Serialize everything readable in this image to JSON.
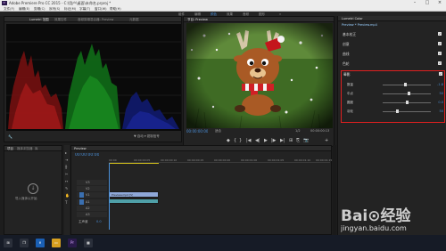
{
  "window": {
    "title": "Adobe Premiere Pro CC 2015 - C:\\用户\\桌面\\未命名.prproj *",
    "icon": "Pr"
  },
  "menu": [
    "文件(F)",
    "编辑(E)",
    "剪辑(C)",
    "序列(S)",
    "标记(M)",
    "字幕(T)",
    "窗口(W)",
    "帮助(H)"
  ],
  "workspace_tabs": [
    "组件",
    "编辑",
    "颜色",
    "效果",
    "音频",
    "图形"
  ],
  "workspace_active": "颜色",
  "scopes": {
    "tabs": [
      "Lumetri 范围",
      "效果控件",
      "音频剪辑混合器: Preview",
      "元数据"
    ],
    "active_tab": "Lumetri 范围",
    "bottom_label": "▼ 自动 ▾ 钳制信号"
  },
  "program": {
    "tab_label": "节目: Preview",
    "timecode": "00:00:00:00",
    "fit": "适合",
    "fraction": "1/2",
    "duration": "00:00:00:13",
    "transport": [
      "◆",
      "{",
      "}",
      "|◀",
      "◀|",
      "▶",
      "|▶",
      "▶|",
      "⊞",
      "⎘",
      "📷",
      "+"
    ]
  },
  "lumetri": {
    "tabs": [
      "Lumetri Color",
      "Preview * Preview.mp4"
    ],
    "sections": [
      {
        "label": "基本校正"
      },
      {
        "label": "创意"
      },
      {
        "label": "曲线"
      },
      {
        "label": "色轮"
      },
      {
        "label": "HSL 辅助"
      }
    ],
    "vignette": {
      "title": "晕影",
      "controls": [
        {
          "label": "数量",
          "value": "-1.8",
          "position": 0.48
        },
        {
          "label": "中点",
          "value": "50",
          "position": 0.55
        },
        {
          "label": "圆度",
          "value": "0.0",
          "position": 0.5
        },
        {
          "label": "羽化",
          "value": "50",
          "position": 0.3
        }
      ]
    }
  },
  "project": {
    "tabs": [
      "项目",
      "媒体浏览器",
      "库"
    ],
    "import_text": "导入媒体以开始"
  },
  "timeline": {
    "tab": "Preview",
    "timecode": "00:00:00:00",
    "ruler": [
      "00:00",
      "00:00:00:05",
      "00:00:00:10",
      "00:00:00:15",
      "00:00:00:20",
      "00:00:01:00",
      "00:00:01:05",
      "00:00:01:10",
      "00:00:01:15"
    ],
    "video_tracks": [
      "V3",
      "V2",
      "V1"
    ],
    "audio_tracks": [
      "A1",
      "A2",
      "A3"
    ],
    "master": "主声道",
    "master_value": "0.0",
    "clip_label": "Preview.mp4 [V]"
  },
  "watermark": {
    "brand": "Bai⊙经验",
    "url": "jingyan.baidu.com"
  },
  "colors": {
    "accent": "#4a8fd8",
    "highlight": "#e02020"
  }
}
